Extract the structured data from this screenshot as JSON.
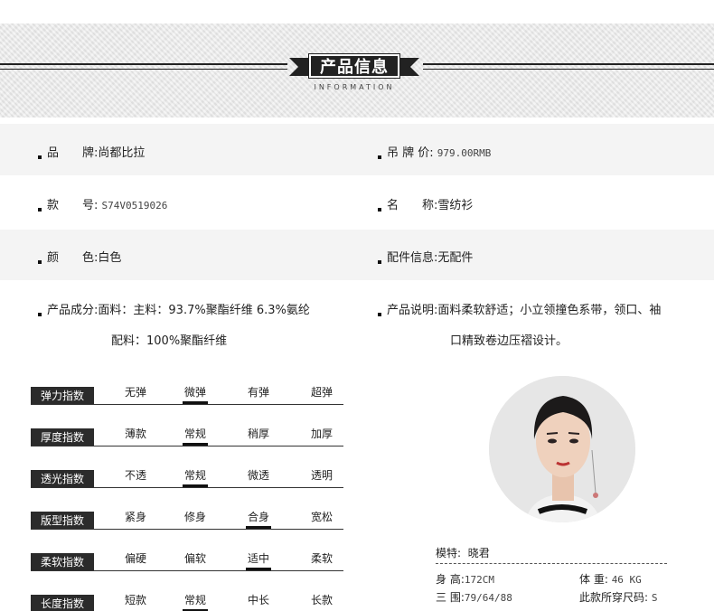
{
  "header": {
    "title": "产品信息",
    "subtitle": "INFORMATION"
  },
  "info": {
    "brand_label": "品　　牌:",
    "brand_value": "尚都比拉",
    "price_label": "吊 牌 价:",
    "price_value": "979.00RMB",
    "sku_label": "款　　号:",
    "sku_value": "S74V0519026",
    "name_label": "名　　称:",
    "name_value": "雪纺衫",
    "color_label": "颜　　色:",
    "color_value": "白色",
    "accessory_label": "配件信息:",
    "accessory_value": "无配件",
    "composition_label": "产品成分:",
    "composition_line1_prefix": "面料：主料：",
    "composition_line1_value": "93.7%聚酯纤维 6.3%氨纶",
    "composition_line2_prefix": "配料：",
    "composition_line2_value": "100%聚酯纤维",
    "description_label": "产品说明:",
    "description_line1": "面料柔软舒适；小立领撞色系带，领口、袖",
    "description_line2": "口精致卷边压褶设计。"
  },
  "indices": [
    {
      "label": "弹力指数",
      "options": [
        "无弹",
        "微弹",
        "有弹",
        "超弹"
      ],
      "selected": 1
    },
    {
      "label": "厚度指数",
      "options": [
        "薄款",
        "常规",
        "稍厚",
        "加厚"
      ],
      "selected": 1
    },
    {
      "label": "透光指数",
      "options": [
        "不透",
        "常规",
        "微透",
        "透明"
      ],
      "selected": 1
    },
    {
      "label": "版型指数",
      "options": [
        "紧身",
        "修身",
        "合身",
        "宽松"
      ],
      "selected": 2
    },
    {
      "label": "柔软指数",
      "options": [
        "偏硬",
        "偏软",
        "适中",
        "柔软"
      ],
      "selected": 2
    },
    {
      "label": "长度指数",
      "options": [
        "短款",
        "常规",
        "中长",
        "长款"
      ],
      "selected": 1
    }
  ],
  "model": {
    "title_label": "模特:",
    "title_value": "晓君",
    "height_label": "身 高:",
    "height_value": "172CM",
    "weight_label": "体 重:",
    "weight_value": "46 KG",
    "measure_label": "三 围:",
    "measure_value": "79/64/88",
    "size_label": "此款所穿尺码:",
    "size_value": "S"
  },
  "colors": {
    "dark": "#222222",
    "band": "#ebebeb",
    "shaded_row": "#f4f4f4"
  }
}
